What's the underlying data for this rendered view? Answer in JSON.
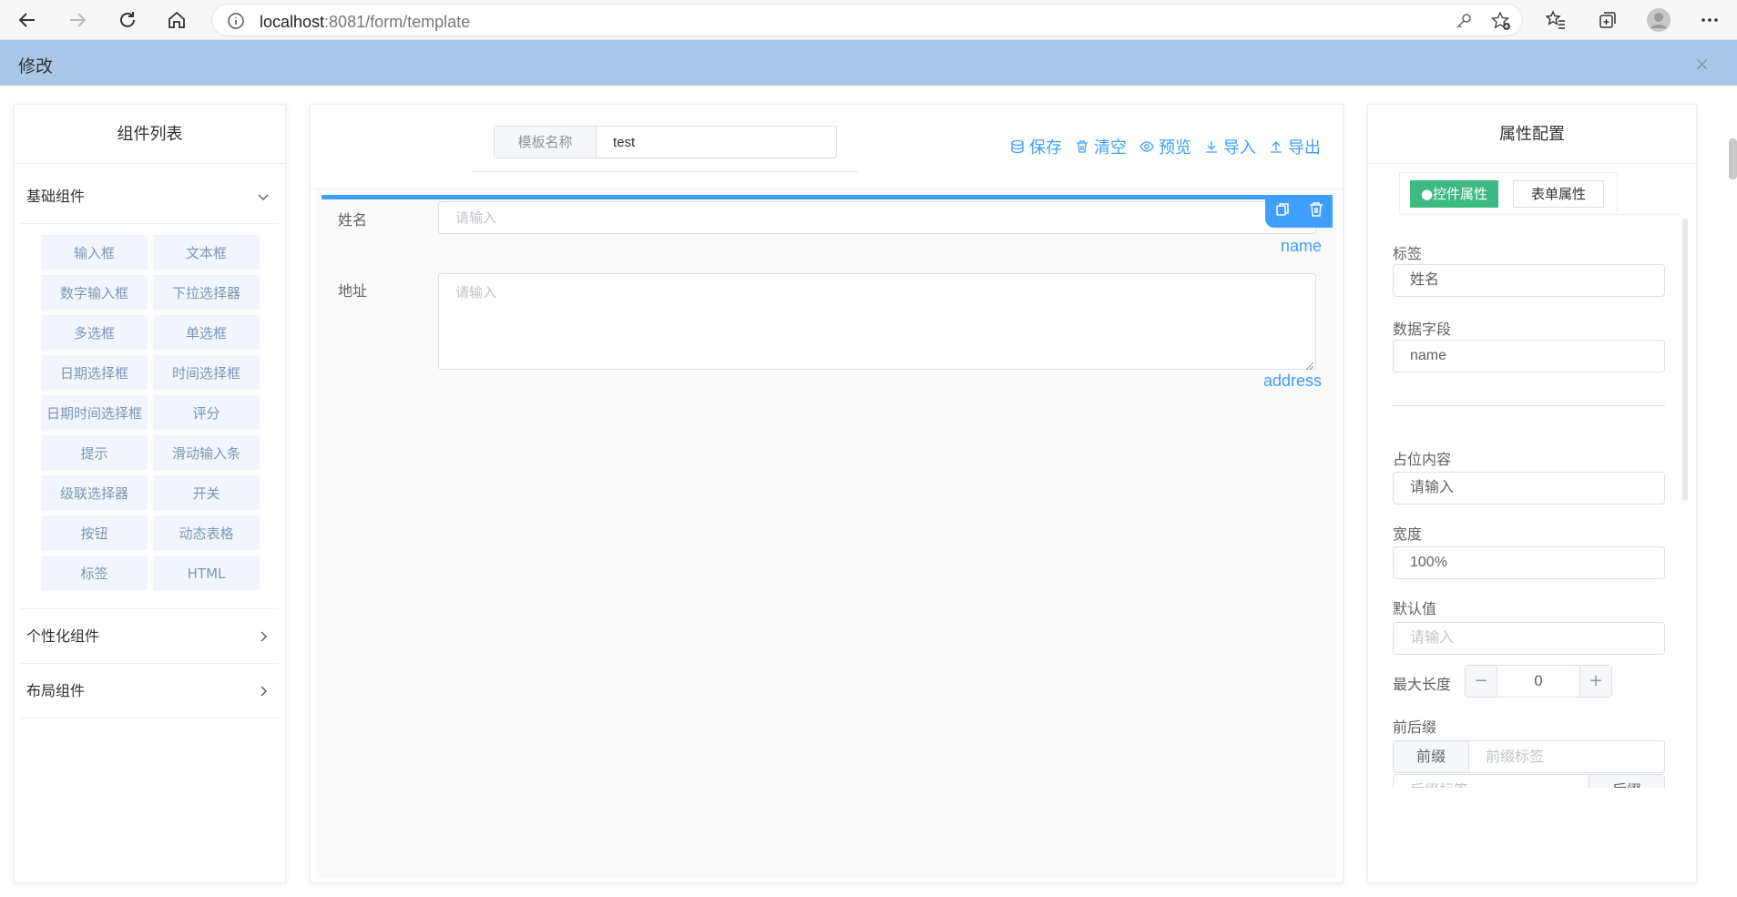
{
  "browser": {
    "url_host": "localhost",
    "url_rest": ":8081/form/template"
  },
  "dialog": {
    "title": "修改",
    "close_glyph": "×"
  },
  "left": {
    "title": "组件列表",
    "groups": [
      {
        "label": "基础组件",
        "expanded": true
      },
      {
        "label": "个性化组件",
        "expanded": false
      },
      {
        "label": "布局组件",
        "expanded": false
      }
    ],
    "components": [
      "输入框",
      "文本框",
      "数字输入框",
      "下拉选择器",
      "多选框",
      "单选框",
      "日期选择框",
      "时间选择框",
      "日期时间选择框",
      "评分",
      "提示",
      "滑动输入条",
      "级联选择器",
      "开关",
      "按钮",
      "动态表格",
      "标签",
      "HTML"
    ]
  },
  "center": {
    "template_name_label": "模板名称",
    "template_name_value": "test",
    "toolbar": {
      "save": "保存",
      "clear": "清空",
      "preview": "预览",
      "import": "导入",
      "export": "导出"
    },
    "fields": [
      {
        "label": "姓名",
        "placeholder": "请输入",
        "key": "name"
      },
      {
        "label": "地址",
        "placeholder": "请输入",
        "key": "address"
      }
    ]
  },
  "right": {
    "title": "属性配置",
    "tabs": {
      "active": "●控件属性",
      "other": "表单属性"
    },
    "props": {
      "label_label": "标签",
      "label_value": "姓名",
      "field_label": "数据字段",
      "field_value": "name",
      "placeholder_label": "占位内容",
      "placeholder_value": "请输入",
      "width_label": "宽度",
      "width_value": "100%",
      "default_label": "默认值",
      "default_placeholder": "请输入",
      "maxlen_label": "最大长度",
      "maxlen_value": "0",
      "affix_label": "前后缀",
      "prefix_btn": "前缀",
      "prefix_placeholder": "前缀标签",
      "suffix_placeholder": "后缀标签",
      "suffix_btn": "后缀"
    }
  },
  "colors": {
    "accent": "#409eff",
    "tab_active": "#3dba83",
    "header_bg": "#a9c8e8"
  }
}
